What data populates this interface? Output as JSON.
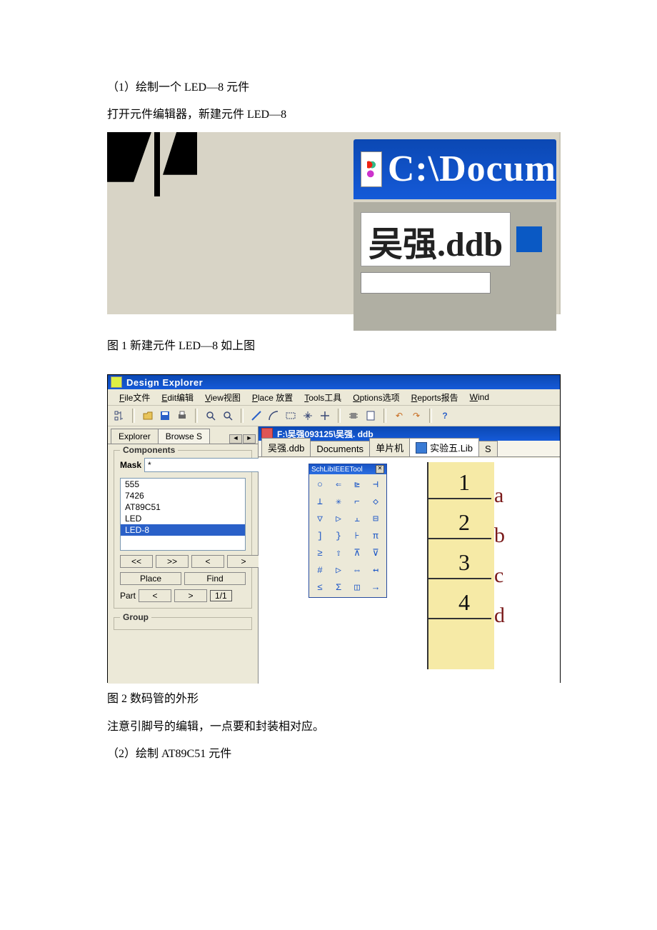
{
  "text": {
    "p1": "（1）绘制一个 LED—8 元件",
    "p2": "打开元件编辑器，新建元件 LED—8",
    "caption1": "图 1 新建元件 LED—8 如上图",
    "caption2": "图 2 数码管的外形",
    "p3": "注意引脚号的编辑，一点要和封装相对应。",
    "p4": "（2）绘制 AT89C51 元件"
  },
  "shot1": {
    "titlebar_text": "C:\\Docum",
    "tab_label": "吴强.ddb"
  },
  "shot2": {
    "window_title": "Design Explorer",
    "menus": {
      "file": "File文件",
      "edit": "Edit编辑",
      "view": "View视图",
      "place": "Place 放置",
      "tools": "Tools工具",
      "options": "Options选项",
      "reports": "Reports报告",
      "window": "Wind"
    },
    "left": {
      "tab_explorer": "Explorer",
      "tab_browse": "Browse S",
      "components_label": "Components",
      "mask_label": "Mask",
      "mask_value": "*",
      "items": [
        "555",
        "7426",
        "AT89C51",
        "LED",
        "LED-8"
      ],
      "selected_index": 4,
      "nav": {
        "first": "<<",
        "next": ">>",
        "prev": "<",
        "last": ">"
      },
      "place_btn": "Place",
      "find_btn": "Find",
      "part_label": "Part",
      "part_prev": "<",
      "part_next": ">",
      "part_count": "1/1",
      "group_label": "Group"
    },
    "mdi": {
      "title": "F:\\吴强093125\\吴强. ddb",
      "tabs": [
        {
          "label": "吴强.ddb",
          "active": false
        },
        {
          "label": "Documents",
          "active": false
        },
        {
          "label": "单片机",
          "active": false
        },
        {
          "label": "实验五.Lib",
          "active": true,
          "icon": true
        },
        {
          "label": "S",
          "active": false
        }
      ],
      "palette_title": "SchLibIEEETool",
      "palette_glyphs": [
        "○",
        "⇐",
        "⊵",
        "⊣",
        "⊥",
        "✳",
        "⌐",
        "◇",
        "▽",
        "▷",
        "⫠",
        "⊟",
        "]",
        "}",
        "⊦",
        "π",
        "≥",
        "⇧",
        "⊼",
        "⊽",
        "#",
        "▷",
        "⇔",
        "↤",
        "≤",
        "Σ",
        "◫",
        "→"
      ],
      "segment_numbers": [
        "1",
        "2",
        "3",
        "4"
      ],
      "segment_letters": [
        "a",
        "b",
        "c",
        "d"
      ]
    }
  }
}
